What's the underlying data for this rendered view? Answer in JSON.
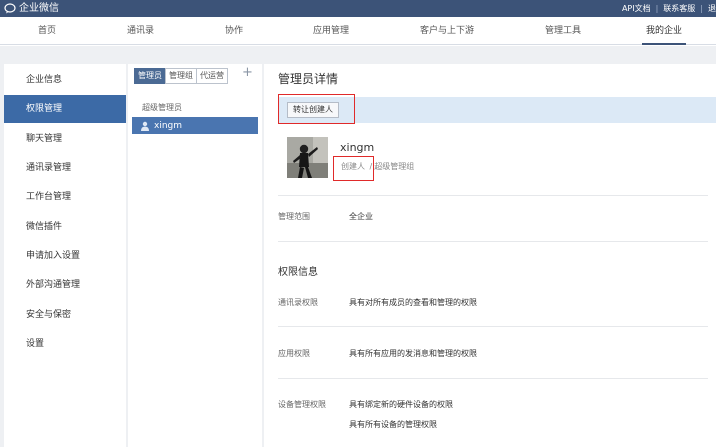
{
  "topbar": {
    "brand": "企业微信",
    "links": [
      "API文档",
      "联系客服",
      "退"
    ]
  },
  "nav": {
    "items": [
      "首页",
      "通讯录",
      "协作",
      "应用管理",
      "客户与上下游",
      "管理工具",
      "我的企业"
    ],
    "active": "我的企业"
  },
  "sidebar": {
    "items": [
      "企业信息",
      "权限管理",
      "聊天管理",
      "通讯录管理",
      "工作台管理",
      "微信插件",
      "申请加入设置",
      "外部沟通管理",
      "安全与保密",
      "设置"
    ],
    "active": "权限管理"
  },
  "middle": {
    "tabs": [
      "管理员",
      "管理组",
      "代运营"
    ],
    "add_symbol": "+",
    "group_title": "超级管理员",
    "admin_name": "xingm"
  },
  "detail": {
    "title": "管理员详情",
    "transfer_button": "转让创建人",
    "profile": {
      "name": "xingm",
      "role_primary": "创建人",
      "role_separator": "/",
      "role_secondary": "超级管理组"
    },
    "scope_label": "管理范围",
    "scope_value": "全企业",
    "permissions_title": "权限信息",
    "permissions": [
      {
        "label": "通讯录权限",
        "values": [
          "具有对所有成员的查看和管理的权限"
        ]
      },
      {
        "label": "应用权限",
        "values": [
          "具有所有应用的发消息和管理的权限"
        ]
      },
      {
        "label": "设备管理权限",
        "values": [
          "具有绑定新的硬件设备的权限",
          "具有所有设备的管理权限"
        ]
      }
    ]
  },
  "colors": {
    "topbar": "#3c5378",
    "accent": "#3c6aa6",
    "highlight": "#e02a2a",
    "action_bar": "#dce9f6"
  },
  "icons": [
    "chat-bubble-logo-icon",
    "add-icon",
    "user-icon"
  ]
}
